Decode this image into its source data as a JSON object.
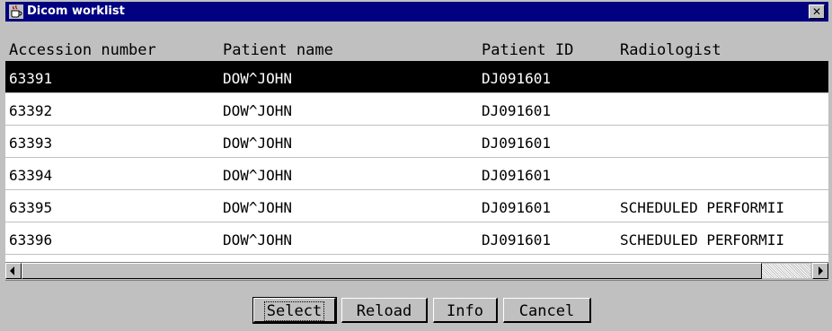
{
  "window": {
    "title": "Dicom worklist",
    "close_label": "✕"
  },
  "table": {
    "columns": [
      "Accession number",
      "Patient name",
      "Patient ID",
      "Radiologist"
    ],
    "rows": [
      {
        "accession": "63391",
        "name": "DOW^JOHN",
        "pid": "DJ091601",
        "radiologist": "",
        "selected": true
      },
      {
        "accession": "63392",
        "name": "DOW^JOHN",
        "pid": "DJ091601",
        "radiologist": ""
      },
      {
        "accession": "63393",
        "name": "DOW^JOHN",
        "pid": "DJ091601",
        "radiologist": ""
      },
      {
        "accession": "63394",
        "name": "DOW^JOHN",
        "pid": "DJ091601",
        "radiologist": ""
      },
      {
        "accession": "63395",
        "name": "DOW^JOHN",
        "pid": "DJ091601",
        "radiologist": "SCHEDULED PERFORMII"
      },
      {
        "accession": "63396",
        "name": "DOW^JOHN",
        "pid": "DJ091601",
        "radiologist": "SCHEDULED PERFORMII"
      }
    ]
  },
  "buttons": {
    "select": "Select",
    "reload": "Reload",
    "info": "Info",
    "cancel": "Cancel"
  },
  "colors": {
    "titlebar": "#000080",
    "selection": "#000000",
    "face": "#c0c0c0"
  }
}
